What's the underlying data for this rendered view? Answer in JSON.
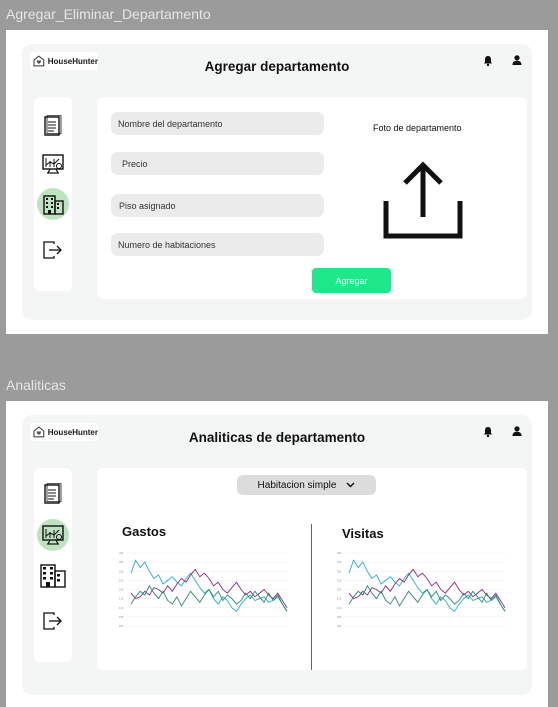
{
  "frames": {
    "agregar": {
      "label": "Agregar_Eliminar_Departamento"
    },
    "analiticas": {
      "label": "Analiticas"
    }
  },
  "brand": {
    "name": "HouseHunter"
  },
  "agregar": {
    "title": "Agregar departamento",
    "fields": [
      {
        "placeholder": "Nombre del departamento"
      },
      {
        "placeholder": "Precio"
      },
      {
        "placeholder": "Piso asignado"
      },
      {
        "placeholder": "Numero de habitaciones"
      }
    ],
    "photo_label": "Foto de departamento",
    "add_button": "Agregar"
  },
  "analiticas": {
    "title": "Analiticas de departamento",
    "room_select": {
      "selected": "Habitacion simple"
    },
    "charts": [
      {
        "title": "Gastos"
      },
      {
        "title": "Visitas"
      }
    ]
  },
  "icons": {
    "notifications": "bell-icon",
    "profile": "user-icon",
    "sidebar": [
      "report-icon",
      "analytics-monitor-icon",
      "building-icon",
      "logout-icon"
    ]
  },
  "colors": {
    "accent_green": "#1ee88a",
    "active_highlight": "#bfe3c0",
    "series": [
      "#27aecb",
      "#8a2a8c",
      "#2d8a78"
    ]
  },
  "chart_data": [
    {
      "type": "line",
      "ylim": [
        0,
        4
      ],
      "yticks": [
        "4.0",
        "3.5",
        "3.0",
        "2.5",
        "2.0",
        "1.5",
        "1.0",
        "0.5",
        "0.0"
      ],
      "series": [
        {
          "values": [
            2.9,
            3.6,
            3.2,
            3.5,
            3.0,
            2.6,
            2.8,
            2.3,
            2.5,
            2.7,
            2.4,
            2.2,
            2.6,
            2.9,
            2.5,
            2.1,
            1.8,
            2.0,
            1.5,
            1.2,
            1.6,
            1.4,
            1.0,
            0.8,
            1.2,
            1.5,
            1.7,
            1.4,
            1.5,
            1.6,
            1.3,
            1.4,
            1.6,
            1.2,
            0.8
          ]
        },
        {
          "values": [
            1.8,
            1.5,
            1.6,
            1.9,
            1.7,
            2.1,
            2.0,
            1.8,
            2.2,
            1.9,
            2.3,
            2.6,
            2.4,
            2.8,
            3.1,
            2.7,
            2.9,
            2.6,
            2.2,
            2.4,
            2.0,
            1.8,
            2.1,
            2.4,
            2.0,
            1.7,
            1.9,
            1.6,
            1.8,
            2.0,
            1.7,
            1.5,
            1.8,
            1.4,
            1.0
          ]
        },
        {
          "values": [
            1.2,
            1.6,
            1.9,
            1.7,
            2.2,
            1.8,
            1.5,
            1.9,
            1.4,
            1.2,
            1.6,
            1.1,
            1.5,
            1.9,
            1.6,
            1.3,
            1.7,
            2.0,
            1.6,
            1.9,
            1.4,
            1.7,
            1.5,
            1.2,
            1.4,
            1.8,
            1.5,
            1.9,
            1.6,
            1.3,
            1.8,
            1.4,
            1.7,
            1.2,
            0.8
          ]
        }
      ]
    },
    {
      "type": "line",
      "ylim": [
        0,
        4
      ],
      "yticks": [
        "4.0",
        "3.5",
        "3.0",
        "2.5",
        "2.0",
        "1.5",
        "1.0",
        "0.5",
        "0.0"
      ],
      "series": [
        {
          "values": [
            2.9,
            3.6,
            3.2,
            3.5,
            3.0,
            2.6,
            2.8,
            2.3,
            2.5,
            2.7,
            2.4,
            2.2,
            2.6,
            2.9,
            2.5,
            2.1,
            1.8,
            2.0,
            1.5,
            1.2,
            1.6,
            1.4,
            1.0,
            0.8,
            1.2,
            1.5,
            1.7,
            1.4,
            1.5,
            1.6,
            1.3,
            1.4,
            1.6,
            1.2,
            0.8
          ]
        },
        {
          "values": [
            1.8,
            1.5,
            1.6,
            1.9,
            1.7,
            2.1,
            2.0,
            1.8,
            2.2,
            1.9,
            2.3,
            2.6,
            2.4,
            2.8,
            3.1,
            2.7,
            2.9,
            2.6,
            2.2,
            2.4,
            2.0,
            1.8,
            2.1,
            2.4,
            2.0,
            1.7,
            1.9,
            1.6,
            1.8,
            2.0,
            1.7,
            1.5,
            1.8,
            1.4,
            1.0
          ]
        },
        {
          "values": [
            1.2,
            1.6,
            1.9,
            1.7,
            2.2,
            1.8,
            1.5,
            1.9,
            1.4,
            1.2,
            1.6,
            1.1,
            1.5,
            1.9,
            1.6,
            1.3,
            1.7,
            2.0,
            1.6,
            1.9,
            1.4,
            1.7,
            1.5,
            1.2,
            1.4,
            1.8,
            1.5,
            1.9,
            1.6,
            1.3,
            1.8,
            1.4,
            1.7,
            1.2,
            0.8
          ]
        }
      ]
    }
  ]
}
